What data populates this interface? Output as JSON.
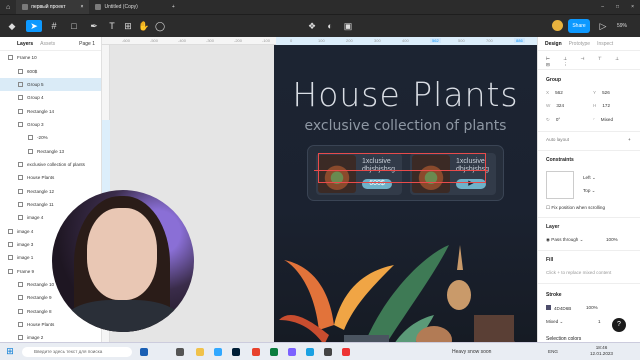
{
  "tabs": [
    {
      "label": "первый проект"
    },
    {
      "label": "Untitled (Copy)"
    }
  ],
  "toolbar": {
    "share_label": "Share",
    "zoom": "59%"
  },
  "left_panel": {
    "tab_layers": "Layers",
    "tab_assets": "Assets",
    "page": "Page 1",
    "layers": [
      {
        "label": "Frame 10"
      },
      {
        "label": "600$"
      },
      {
        "label": "Group 5"
      },
      {
        "label": "Group 4"
      },
      {
        "label": "Rectangle 14"
      },
      {
        "label": "Group 3"
      },
      {
        "label": "-20%"
      },
      {
        "label": "Rectangle 13"
      },
      {
        "label": "exclusive collection of plants"
      },
      {
        "label": "House Plants"
      },
      {
        "label": "Rectangle 12"
      },
      {
        "label": "Rectangle 11"
      },
      {
        "label": "image 4"
      },
      {
        "label": "image 4"
      },
      {
        "label": "image 3"
      },
      {
        "label": "image 1"
      },
      {
        "label": "Frame 9"
      },
      {
        "label": "Rectangle 10"
      },
      {
        "label": "Rectangle 9"
      },
      {
        "label": "Rectangle 8"
      },
      {
        "label": "House Plants"
      },
      {
        "label": "image 2"
      }
    ]
  },
  "ruler": {
    "ticks": [
      "-600",
      "-500",
      "-400",
      "-300",
      "-200",
      "-100",
      "0",
      "100",
      "200",
      "300",
      "400",
      "562",
      "500",
      "700",
      "886"
    ]
  },
  "canvas": {
    "title": "House Plants",
    "subtitle": "exclusive collection of plants",
    "cards": [
      {
        "name_line1": "1xclusive",
        "name_line2": "dhjshjshsg",
        "price": "600$"
      },
      {
        "name_line1": "1xclusive",
        "name_line2": "dhjshjshsg",
        "button": "▶"
      }
    ]
  },
  "right_panel": {
    "tab_design": "Design",
    "tab_prototype": "Prototype",
    "tab_inspect": "Inspect",
    "group_title": "Group",
    "x": "562",
    "y": "526",
    "w": "324",
    "h": "172",
    "rotation": "0°",
    "corner": "Mixed",
    "auto_layout": "Auto layout",
    "constraints": "Constraints",
    "constraint_h": "Left",
    "constraint_v": "Top",
    "fix_scroll": "Fix position when scrolling",
    "layer": "Layer",
    "pass_through": "Pass through",
    "opacity": "100%",
    "fill": "Fill",
    "fill_hint": "Click + to replace mixed content",
    "stroke": "Stroke",
    "stroke_color": "4D4D6B",
    "stroke_opacity": "100%",
    "stroke_mode": "Mixed",
    "stroke_weight": "1",
    "selection_colors": "Selection colors"
  },
  "taskbar": {
    "search_placeholder": "Введите здесь текст для поиска",
    "weather": "Heavy snow soon",
    "lang": "ENG",
    "time": "18:46",
    "date": "12.01.2023"
  },
  "colors": {
    "accent": "#0d99ff",
    "frame_bg": "#1c2432",
    "price_pill": "#6fb2c9",
    "selection": "#e84b4b"
  }
}
